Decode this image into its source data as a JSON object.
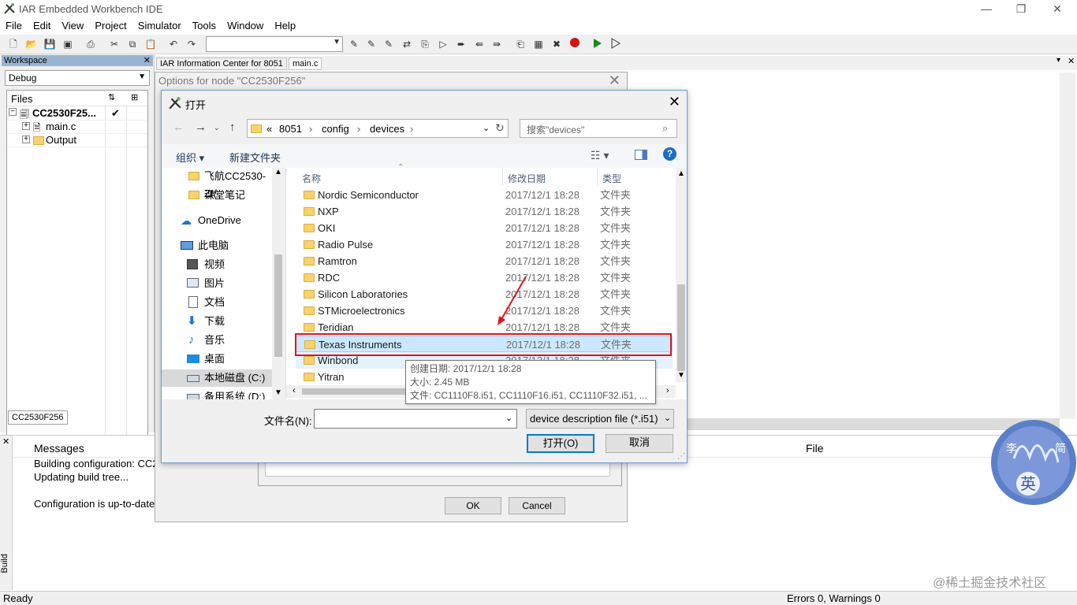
{
  "app": {
    "title": "IAR Embedded Workbench IDE"
  },
  "menu": [
    "File",
    "Edit",
    "View",
    "Project",
    "Simulator",
    "Tools",
    "Window",
    "Help"
  ],
  "workspace": {
    "header": "Workspace",
    "config": "Debug",
    "files_header": "Files",
    "tree": [
      {
        "label": "CC2530F25...",
        "check": "✔"
      },
      {
        "label": "main.c"
      },
      {
        "label": "Output"
      }
    ],
    "bottom_tab": "CC2530F256"
  },
  "editor": {
    "tabs": [
      "IAR Information Center for 8051",
      "main.c"
    ]
  },
  "options_dialog": {
    "title": "Options for node \"CC2530F256\"",
    "ok": "OK",
    "cancel": "Cancel"
  },
  "open_dialog": {
    "title": "打开",
    "breadcrumb": [
      "«",
      "8051",
      "config",
      "devices"
    ],
    "search_placeholder": "搜索\"devices\"",
    "organize": "组织",
    "new_folder": "新建文件夹",
    "nav": [
      {
        "label": "飞航CC2530-ZI(",
        "icon": "folder-icon"
      },
      {
        "label": "课堂笔记",
        "icon": "folder-icon"
      },
      {
        "label": "OneDrive",
        "icon": "cloud-icon"
      },
      {
        "label": "此电脑",
        "icon": "computer-icon"
      },
      {
        "label": "视频",
        "icon": "video-icon"
      },
      {
        "label": "图片",
        "icon": "picture-icon"
      },
      {
        "label": "文档",
        "icon": "document-icon"
      },
      {
        "label": "下载",
        "icon": "download-icon"
      },
      {
        "label": "音乐",
        "icon": "music-icon"
      },
      {
        "label": "桌面",
        "icon": "desktop-icon"
      },
      {
        "label": "本地磁盘 (C:)",
        "icon": "drive-icon"
      },
      {
        "label": "备用系统 (D:)",
        "icon": "drive-icon"
      }
    ],
    "columns": {
      "name": "名称",
      "date": "修改日期",
      "type": "类型"
    },
    "files": [
      {
        "name": "Nordic Semiconductor",
        "date": "2017/12/1 18:28",
        "type": "文件夹"
      },
      {
        "name": "NXP",
        "date": "2017/12/1 18:28",
        "type": "文件夹"
      },
      {
        "name": "OKI",
        "date": "2017/12/1 18:28",
        "type": "文件夹"
      },
      {
        "name": "Radio Pulse",
        "date": "2017/12/1 18:28",
        "type": "文件夹"
      },
      {
        "name": "Ramtron",
        "date": "2017/12/1 18:28",
        "type": "文件夹"
      },
      {
        "name": "RDC",
        "date": "2017/12/1 18:28",
        "type": "文件夹"
      },
      {
        "name": "Silicon Laboratories",
        "date": "2017/12/1 18:28",
        "type": "文件夹"
      },
      {
        "name": "STMicroelectronics",
        "date": "2017/12/1 18:28",
        "type": "文件夹"
      },
      {
        "name": "Teridian",
        "date": "2017/12/1 18:28",
        "type": "文件夹"
      },
      {
        "name": "Texas Instruments",
        "date": "2017/12/1 18:28",
        "type": "文件夹"
      },
      {
        "name": "Winbond",
        "date": "2017/12/1 18:28",
        "type": "文件夹"
      },
      {
        "name": "Yitran",
        "date": "",
        "type": ""
      }
    ],
    "tooltip": [
      "创建日期: 2017/12/1 18:28",
      "大小: 2.45 MB",
      "文件: CC1110F8.i51, CC1110F16.i51, CC1110F32.i51, ..."
    ],
    "filename_label": "文件名(N):",
    "filename_value": "",
    "filter": "device description file (*.i51)",
    "open_button": "打开(O)",
    "cancel_button": "取消"
  },
  "messages": {
    "col_messages": "Messages",
    "col_file": "File",
    "lines": [
      "Building configuration: CC2",
      "Updating build tree...",
      "",
      "Configuration is up-to-date"
    ],
    "side_label": "Build"
  },
  "status": {
    "left": "Ready",
    "right": "Errors 0, Warnings 0"
  },
  "watermark": {
    "text": "@稀土掘金技术社区"
  },
  "colors": {
    "highlight": "#cce8ff",
    "red_annotation": "#e0141e",
    "accent": "#0078d7"
  }
}
